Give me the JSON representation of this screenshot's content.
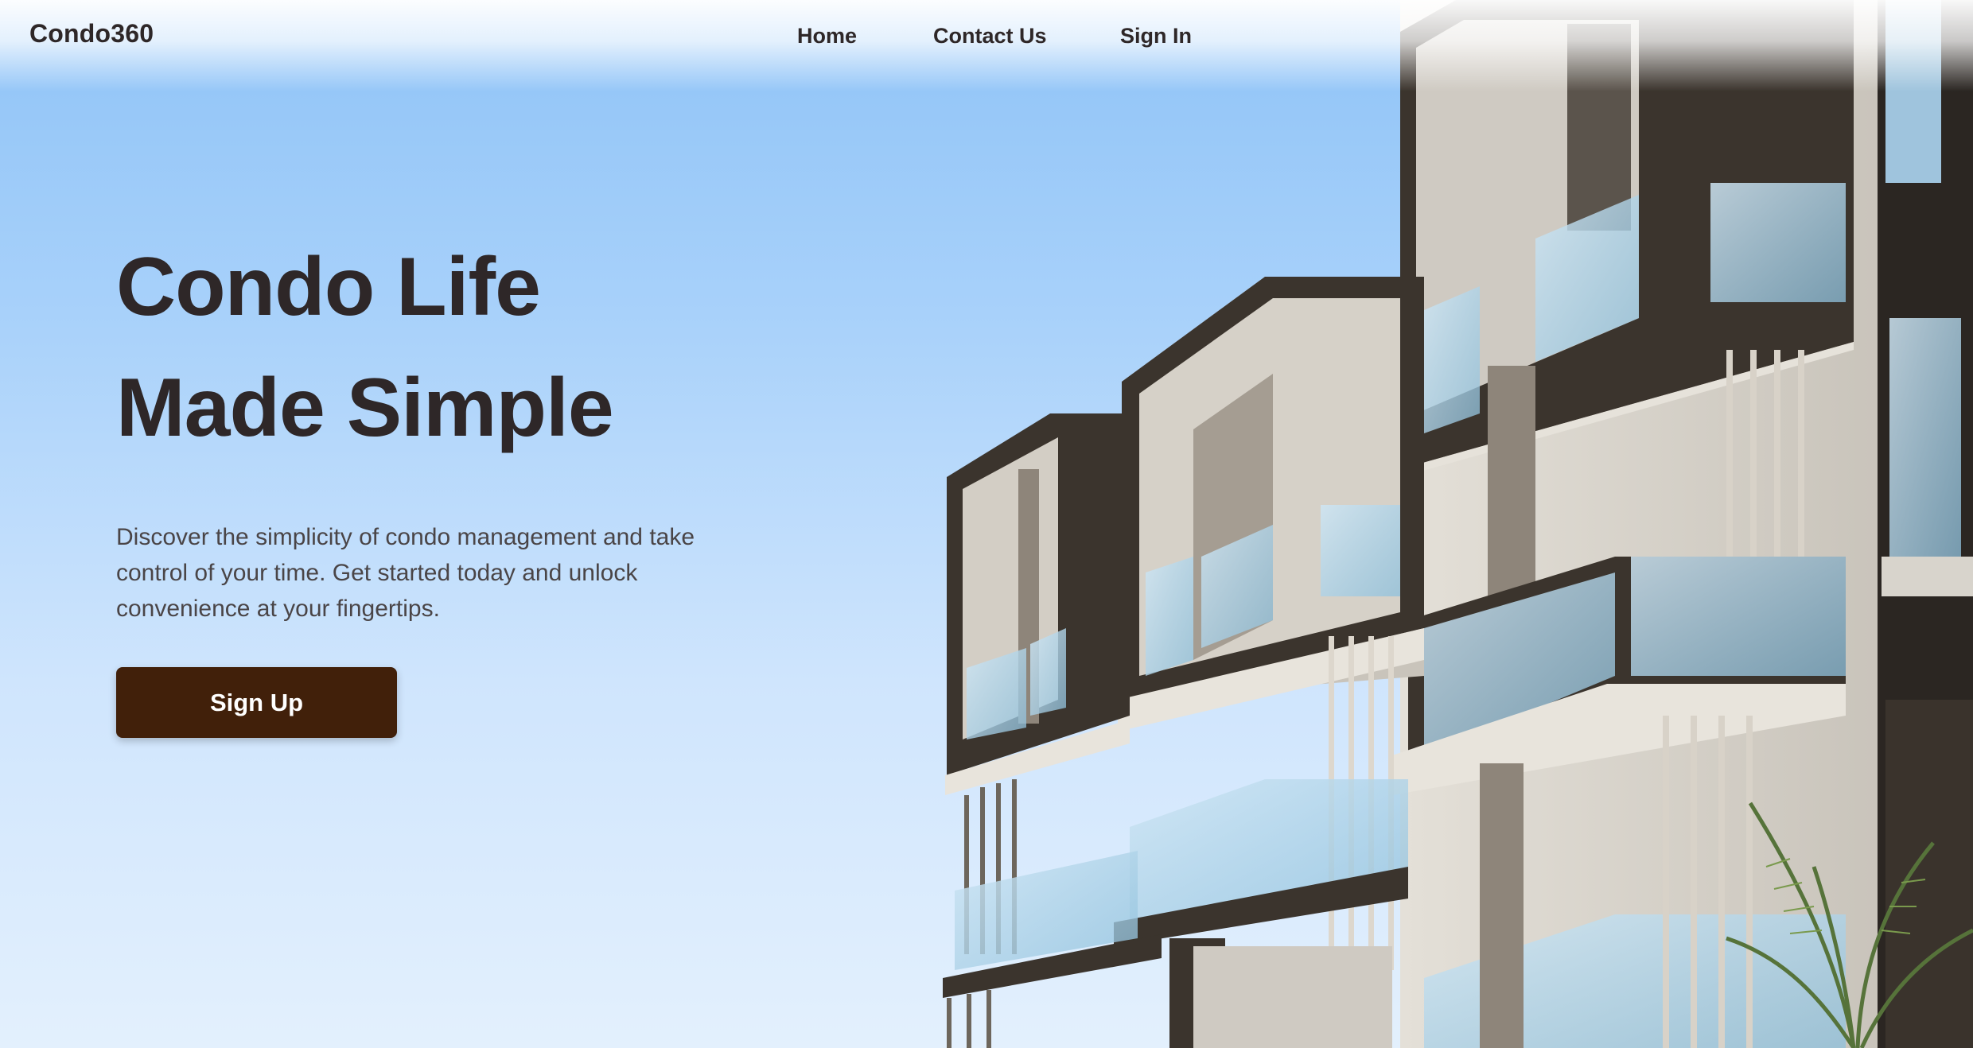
{
  "brand": {
    "name": "Condo360"
  },
  "nav": {
    "items": [
      "Home",
      "Contact Us",
      "Sign In"
    ]
  },
  "hero": {
    "headline_line1": "Condo Life",
    "headline_line2": "Made Simple",
    "subtitle": "Discover the simplicity of condo management and take control of your time. Get started today and unlock convenience at your fingertips.",
    "cta_label": "Sign Up"
  },
  "colors": {
    "sky_top": "#8fc3f7",
    "sky_bottom": "#e3f0fd",
    "text_dark": "#2e2728",
    "cta_background": "#41200a",
    "building_frame": "#3b342d",
    "building_wall": "#d8d4cc"
  }
}
